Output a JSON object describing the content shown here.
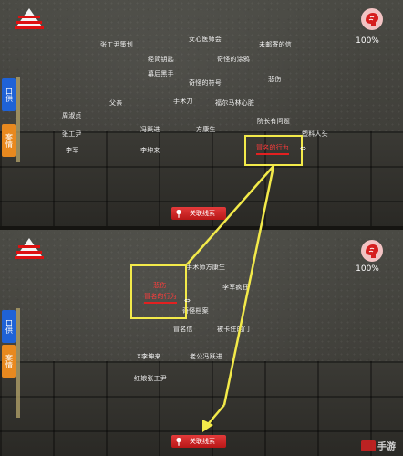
{
  "top": {
    "side_tabs": [
      {
        "label": "口供"
      },
      {
        "label": "案情"
      }
    ],
    "sanity": "100%",
    "clues": [
      {
        "text": "张工尹策划"
      },
      {
        "text": "女心医师会"
      },
      {
        "text": "未邮寄的信"
      },
      {
        "text": "经简钥匙"
      },
      {
        "text": "奇怪的涂鸦"
      },
      {
        "text": "幕后黑手"
      },
      {
        "text": "悲伤"
      },
      {
        "text": "奇怪的符号"
      },
      {
        "text": "父亲"
      },
      {
        "text": "手术刀"
      },
      {
        "text": "福尔马林心脏"
      },
      {
        "text": "周淑贞"
      },
      {
        "text": "冯跃进"
      },
      {
        "text": "方康生"
      },
      {
        "text": "院长有问题"
      },
      {
        "text": "张工尹"
      },
      {
        "text": "塑料人头"
      },
      {
        "text": "李军"
      },
      {
        "text": "李坤来"
      }
    ],
    "selected_clue": "冒名的行为",
    "link_button": "关联线索"
  },
  "bottom": {
    "side_tabs": [
      {
        "label": "口供"
      },
      {
        "label": "案情"
      }
    ],
    "sanity": "100%",
    "clues": [
      {
        "text": "手术师方康生"
      },
      {
        "text": "李军疯狂"
      },
      {
        "text": "奇怪档案"
      },
      {
        "text": "冒名信"
      },
      {
        "text": "被卡住的门"
      },
      {
        "text": "X李坤来"
      },
      {
        "text": "老公冯跃进"
      },
      {
        "text": "红娘张工尹"
      }
    ],
    "selected_clue_lines": [
      "悲伤",
      "冒名的行为"
    ],
    "link_button": "关联线索"
  },
  "watermark": "手游"
}
